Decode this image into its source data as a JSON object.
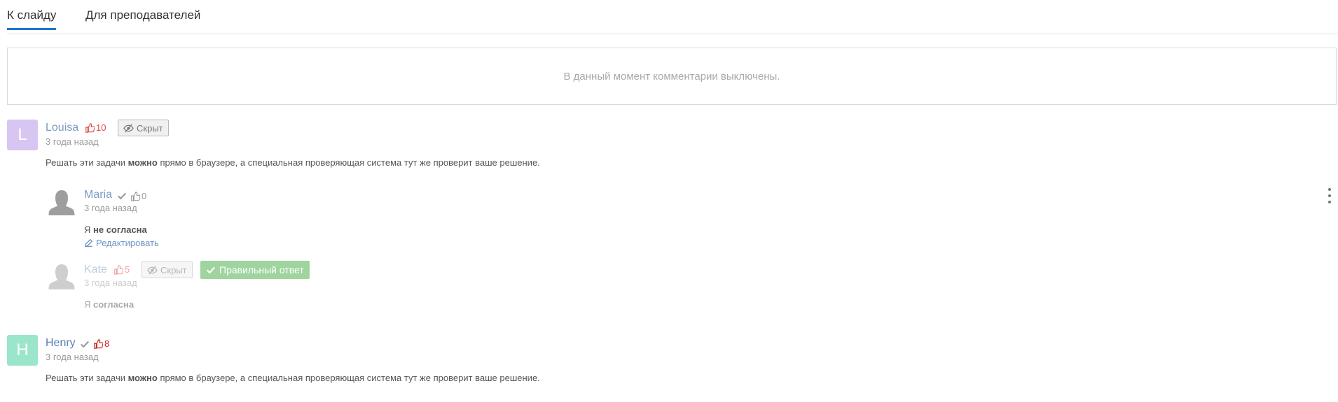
{
  "tabs": [
    {
      "label": "К слайду",
      "active": true
    },
    {
      "label": "Для преподавателей",
      "active": false
    }
  ],
  "notice": "В данный момент комментарии выключены.",
  "colors": {
    "accent": "#1f78c8",
    "like": "#e04848",
    "link": "#6b95c8",
    "correct": "#9fd49f"
  },
  "comments": [
    {
      "avatar_letter": "L",
      "avatar_color": "#d7c6f2",
      "name": "Louisa",
      "likes": "10",
      "hidden_label": "Скрыт",
      "time": "3 года назад",
      "text_before": "Решать эти задачи ",
      "text_bold": "можно",
      "text_after": " прямо в браузере, а специальная проверяющая система тут же проверит ваше решение."
    },
    {
      "name": "Maria",
      "likes": "0",
      "time": "3 года назад",
      "text_before": "Я ",
      "text_bold": "не согласна",
      "edit_label": "Редактировать"
    },
    {
      "name": "Kate",
      "likes": "5",
      "hidden_label": "Скрыт",
      "correct_label": "Правильный ответ",
      "time": "3 года назад",
      "text_before": "Я ",
      "text_bold": "согласна"
    },
    {
      "avatar_letter": "H",
      "avatar_color": "#9be5cb",
      "name": "Henry",
      "likes": "8",
      "time": "3 года назад",
      "text_before": "Решать эти задачи ",
      "text_bold": "можно",
      "text_after": " прямо в браузере, а специальная проверяющая система тут же проверит ваше решение."
    }
  ]
}
